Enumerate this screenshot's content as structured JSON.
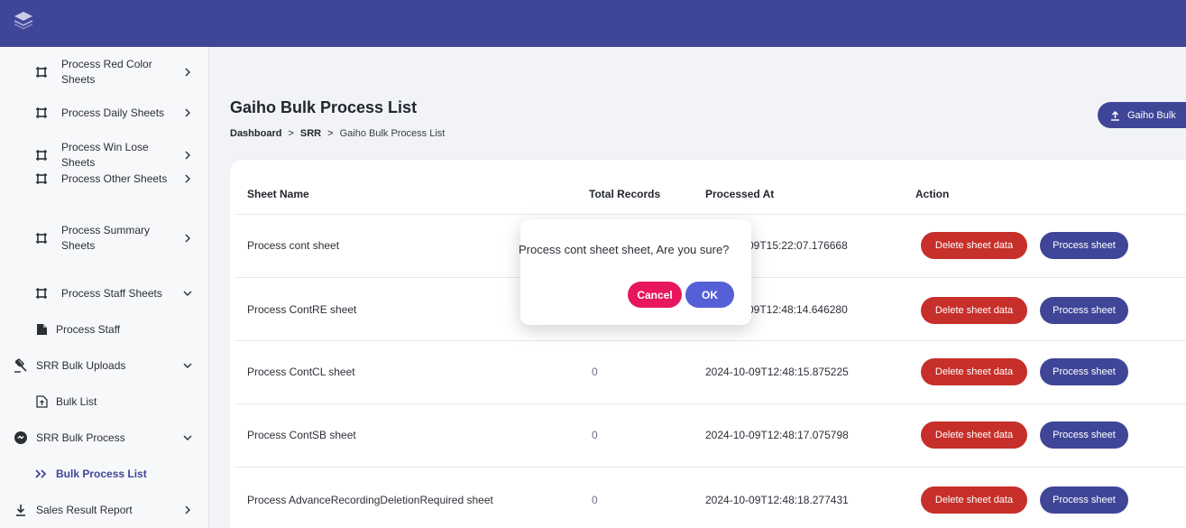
{
  "colors": {
    "brand": "#3f4697",
    "danger": "#c62f2a",
    "cancel": "#e8175d",
    "ok": "#5560d6"
  },
  "sidebar": {
    "items": [
      {
        "label": "Process Red Color Sheets",
        "line1": "Process Red Color",
        "line2": "Sheets",
        "icon": "sheet-icon",
        "chevron": "chevron-right-icon"
      },
      {
        "label": "Process Daily Sheets",
        "icon": "sheet-icon",
        "chevron": "chevron-right-icon"
      },
      {
        "label": "Process Win Lose Sheets",
        "line1": "Process Win Lose",
        "line2": "Sheets",
        "icon": "sheet-icon",
        "chevron": "chevron-right-icon"
      },
      {
        "label": "Process Other Sheets",
        "icon": "sheet-icon",
        "chevron": "chevron-right-icon"
      },
      {
        "label": "Process Summary Sheets",
        "line1": "Process Summary",
        "line2": "Sheets",
        "icon": "sheet-icon",
        "chevron": "chevron-right-icon"
      },
      {
        "label": "Process Staff Sheets",
        "icon": "sheet-icon",
        "chevron": "chevron-down-icon"
      },
      {
        "label": "Process Staff",
        "icon": "file-icon"
      },
      {
        "label": "SRR Bulk Uploads",
        "icon": "gavel-icon",
        "chevron": "chevron-down-icon"
      },
      {
        "label": "Bulk List",
        "icon": "file-upload-icon"
      },
      {
        "label": "SRR Bulk Process",
        "icon": "process-circle-icon",
        "chevron": "chevron-down-icon"
      },
      {
        "label": "Bulk Process List",
        "icon": "double-chevron-icon",
        "active": true
      },
      {
        "label": "Sales Result Report",
        "icon": "download-icon",
        "chevron": "chevron-right-icon"
      }
    ]
  },
  "header": {
    "title": "Gaiho Bulk Process List",
    "breadcrumb": [
      "Dashboard",
      "SRR",
      "Gaiho Bulk Process List"
    ],
    "upload_button": "Gaiho Bulk"
  },
  "table": {
    "columns": [
      "Sheet Name",
      "Total Records",
      "Processed At",
      "Action"
    ],
    "rows": [
      {
        "name": "Process cont sheet",
        "total": "",
        "processed_at": "09T15:22:07.176668"
      },
      {
        "name": "Process ContRE sheet",
        "total": "",
        "processed_at": "09T12:48:14.646280"
      },
      {
        "name": "Process ContCL sheet",
        "total": "0",
        "processed_at": "2024-10-09T12:48:15.875225"
      },
      {
        "name": "Process ContSB sheet",
        "total": "0",
        "processed_at": "2024-10-09T12:48:17.075798"
      },
      {
        "name": "Process AdvanceRecordingDeletionRequired sheet",
        "total": "0",
        "processed_at": "2024-10-09T12:48:18.277431"
      }
    ],
    "delete_label": "Delete sheet data",
    "process_label": "Process sheet"
  },
  "dialog": {
    "message": "Process cont sheet sheet, Are you sure?",
    "cancel_label": "Cancel",
    "ok_label": "OK"
  }
}
